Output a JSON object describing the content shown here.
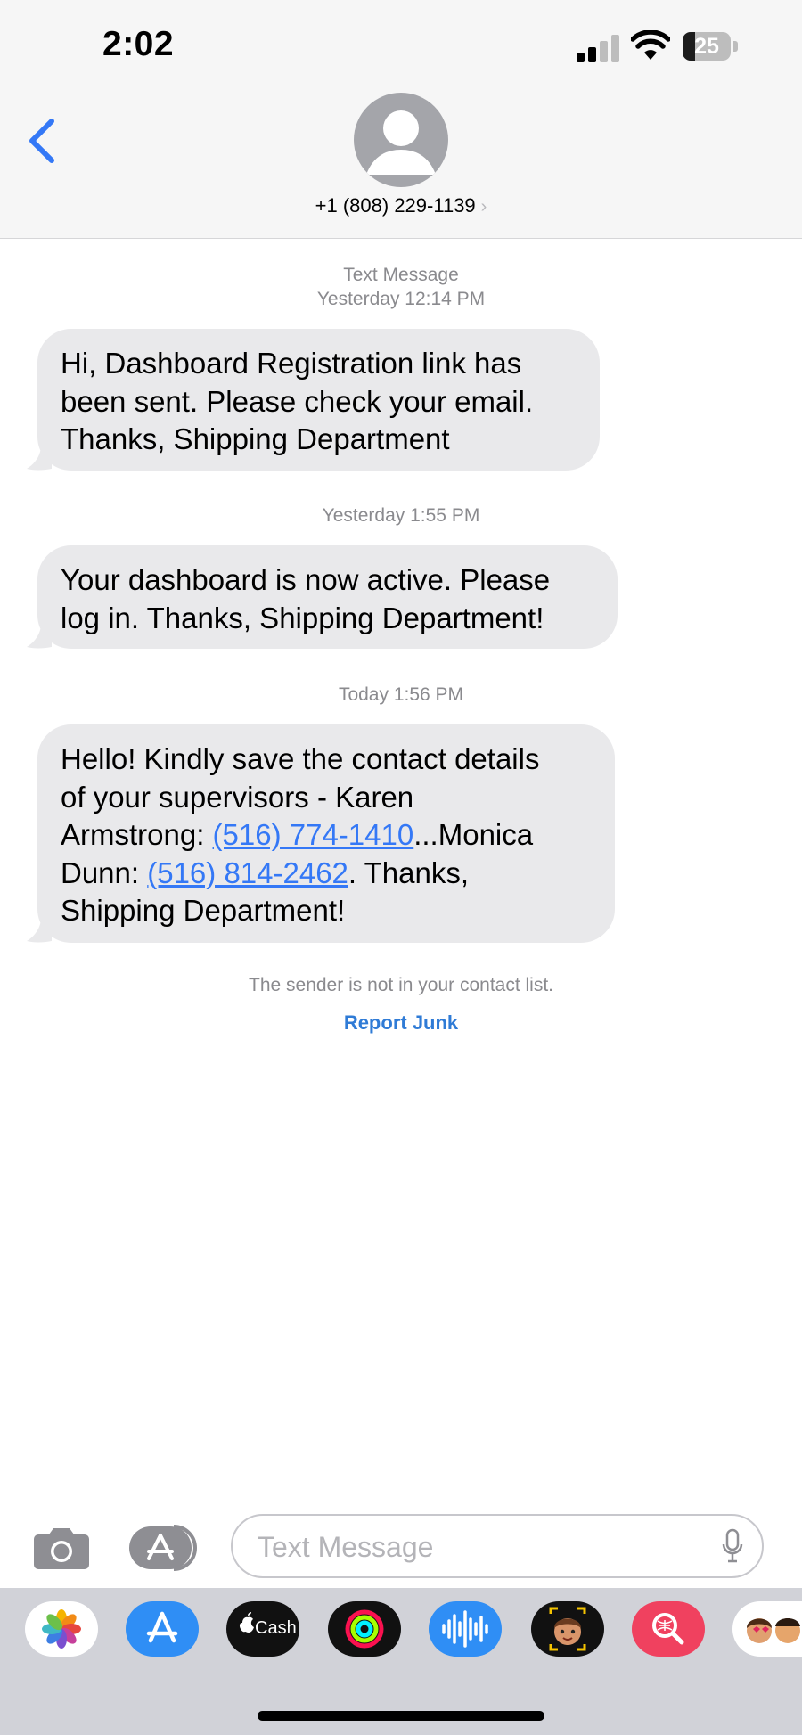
{
  "status_bar": {
    "time": "2:02",
    "battery": "25",
    "battery_level": 0.25
  },
  "header": {
    "contact": "+1 (808) 229-1139",
    "chevron": "›"
  },
  "thread": {
    "messages": [
      {
        "meta_lines": [
          "Text Message",
          "Yesterday 12:14 PM"
        ],
        "lines": [
          "Hi, Dashboard Registration link has",
          "been sent. Please check your email.",
          "Thanks, Shipping Department"
        ]
      },
      {
        "meta_lines": [
          "Yesterday 1:55 PM"
        ],
        "lines": [
          "Your dashboard is now active. Please",
          "log in. Thanks, Shipping Department!"
        ]
      },
      {
        "meta_lines": [
          "Today 1:56 PM"
        ],
        "line1": "Hello! Kindly save the contact details",
        "line2": "of your supervisors - Karen",
        "line3_prefix": "Armstrong: ",
        "phone1": "(516) 774-1410",
        "line3_suffix": "...Monica",
        "line4_prefix": "Dunn: ",
        "phone2": "(516) 814-2462",
        "line4_suffix": ". Thanks,",
        "line5": "Shipping Department!"
      }
    ],
    "notice": "The sender is not in your contact list.",
    "report_junk": "Report Junk"
  },
  "composer": {
    "placeholder": "Text Message"
  },
  "app_tray": {
    "apps": [
      "photos-icon",
      "app-store-icon",
      "apple-cash-icon",
      "activity-icon",
      "audio-message-icon",
      "memoji-icon",
      "image-search-icon",
      "memoji-stickers-icon"
    ],
    "cash_label": "Cash"
  },
  "colors": {
    "accent": "#3478f6",
    "bubble": "#e9e9eb",
    "report": "#2f7bd6"
  }
}
